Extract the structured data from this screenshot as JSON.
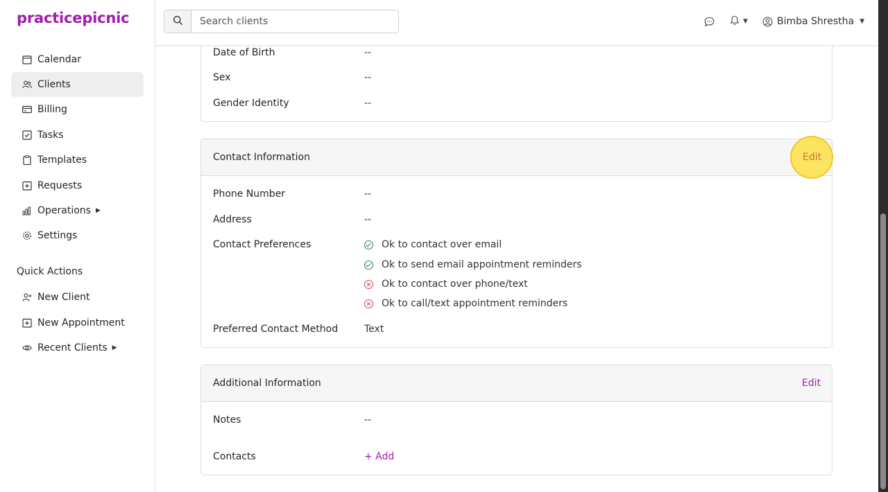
{
  "app": {
    "logo": "practicepicnic"
  },
  "sidebar": {
    "items": [
      {
        "label": "Calendar",
        "icon": "calendar-icon"
      },
      {
        "label": "Clients",
        "icon": "users-icon",
        "active": true
      },
      {
        "label": "Billing",
        "icon": "credit-card-icon"
      },
      {
        "label": "Tasks",
        "icon": "checkbox-icon"
      },
      {
        "label": "Templates",
        "icon": "clipboard-icon"
      },
      {
        "label": "Requests",
        "icon": "plus-square-icon"
      },
      {
        "label": "Operations",
        "icon": "bar-chart-icon",
        "has_submenu": true
      },
      {
        "label": "Settings",
        "icon": "gear-icon"
      }
    ],
    "quick_actions_heading": "Quick Actions",
    "quick_actions": [
      {
        "label": "New Client",
        "icon": "user-plus-icon"
      },
      {
        "label": "New Appointment",
        "icon": "calendar-plus-icon"
      },
      {
        "label": "Recent Clients",
        "icon": "eye-icon",
        "has_submenu": true
      }
    ]
  },
  "topbar": {
    "search_placeholder": "Search clients",
    "user_name": "Bimba Shrestha"
  },
  "demographics": {
    "rows": [
      {
        "label": "Date of Birth",
        "value": "--"
      },
      {
        "label": "Sex",
        "value": "--"
      },
      {
        "label": "Gender Identity",
        "value": "--"
      }
    ]
  },
  "contact": {
    "title": "Contact Information",
    "edit_label": "Edit",
    "phone_label": "Phone Number",
    "phone_value": "--",
    "address_label": "Address",
    "address_value": "--",
    "prefs_label": "Contact Preferences",
    "prefs": [
      {
        "text": "Ok to contact over email",
        "status": "yes"
      },
      {
        "text": "Ok to send email appointment reminders",
        "status": "yes"
      },
      {
        "text": "Ok to contact over phone/text",
        "status": "no"
      },
      {
        "text": "Ok to call/text appointment reminders",
        "status": "no"
      }
    ],
    "method_label": "Preferred Contact Method",
    "method_value": "Text"
  },
  "additional": {
    "title": "Additional Information",
    "edit_label": "Edit",
    "notes_label": "Notes",
    "notes_value": "--",
    "contacts_label": "Contacts",
    "add_label": "+ Add"
  },
  "colors": {
    "brand": "#a21caf",
    "ok": "#1f8a4c",
    "no": "#d9414f",
    "highlight": "#fde047"
  }
}
